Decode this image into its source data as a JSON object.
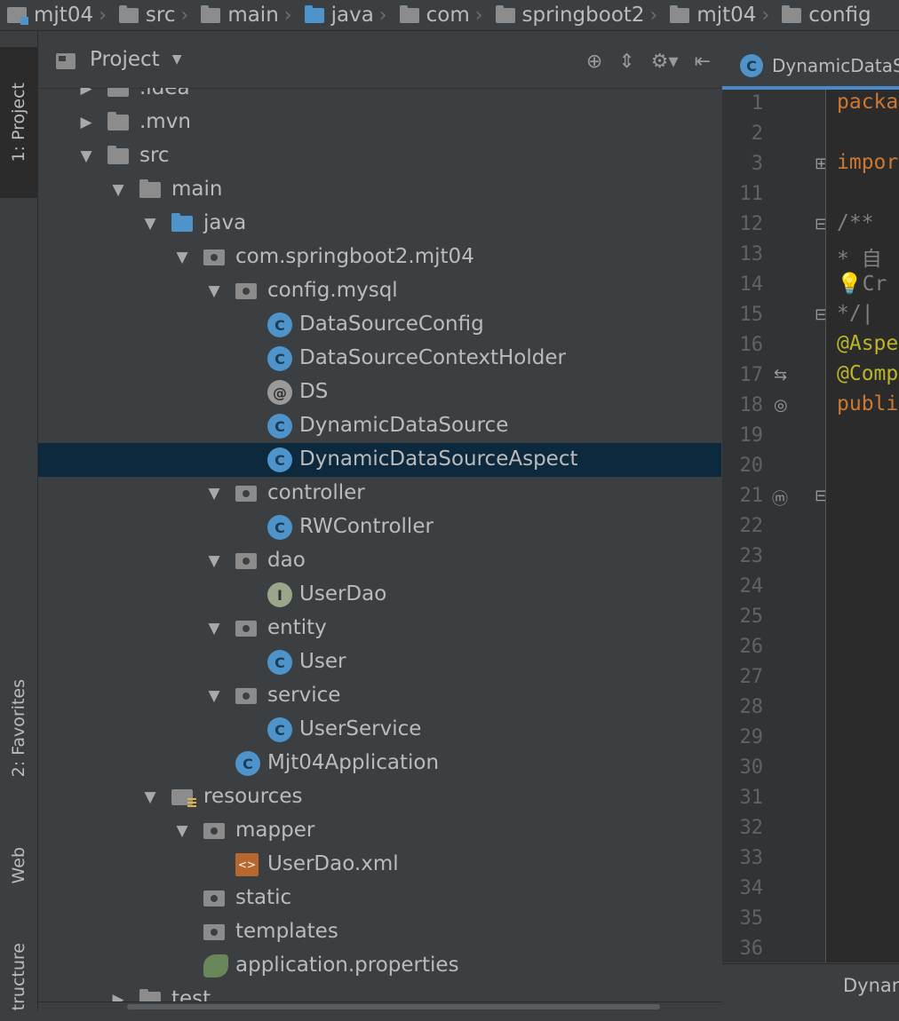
{
  "breadcrumbs": [
    "mjt04",
    "src",
    "main",
    "java",
    "com",
    "springboot2",
    "mjt04",
    "config"
  ],
  "tool_strip": {
    "project": "1: Project",
    "favorites": "2: Favorites",
    "web": "Web",
    "structure": "tructure"
  },
  "panel": {
    "title": "Project"
  },
  "tree": [
    {
      "label": ".idea",
      "arrow": "▶",
      "icon": "folder",
      "depth": 0
    },
    {
      "label": ".mvn",
      "arrow": "▶",
      "icon": "folder",
      "depth": 0
    },
    {
      "label": "src",
      "arrow": "▼",
      "icon": "folder",
      "depth": 0
    },
    {
      "label": "main",
      "arrow": "▼",
      "icon": "folder",
      "depth": 1
    },
    {
      "label": "java",
      "arrow": "▼",
      "icon": "folder-blue",
      "depth": 2
    },
    {
      "label": "com.springboot2.mjt04",
      "arrow": "▼",
      "icon": "package",
      "depth": 3
    },
    {
      "label": "config.mysql",
      "arrow": "▼",
      "icon": "package",
      "depth": 4
    },
    {
      "label": "DataSourceConfig",
      "arrow": "",
      "icon": "class",
      "depth": 5
    },
    {
      "label": "DataSourceContextHolder",
      "arrow": "",
      "icon": "class",
      "depth": 5
    },
    {
      "label": "DS",
      "arrow": "",
      "icon": "annotation",
      "depth": 5
    },
    {
      "label": "DynamicDataSource",
      "arrow": "",
      "icon": "class",
      "depth": 5
    },
    {
      "label": "DynamicDataSourceAspect",
      "arrow": "",
      "icon": "class",
      "depth": 5,
      "selected": true
    },
    {
      "label": "controller",
      "arrow": "▼",
      "icon": "package",
      "depth": 4
    },
    {
      "label": "RWController",
      "arrow": "",
      "icon": "class",
      "depth": 5
    },
    {
      "label": "dao",
      "arrow": "▼",
      "icon": "package",
      "depth": 4
    },
    {
      "label": "UserDao",
      "arrow": "",
      "icon": "interface",
      "depth": 5
    },
    {
      "label": "entity",
      "arrow": "▼",
      "icon": "package",
      "depth": 4
    },
    {
      "label": "User",
      "arrow": "",
      "icon": "class",
      "depth": 5
    },
    {
      "label": "service",
      "arrow": "▼",
      "icon": "package",
      "depth": 4
    },
    {
      "label": "UserService",
      "arrow": "",
      "icon": "class",
      "depth": 5
    },
    {
      "label": "Mjt04Application",
      "arrow": "",
      "icon": "app-class",
      "depth": 4
    },
    {
      "label": "resources",
      "arrow": "▼",
      "icon": "resources",
      "depth": 2
    },
    {
      "label": "mapper",
      "arrow": "▼",
      "icon": "package",
      "depth": 3
    },
    {
      "label": "UserDao.xml",
      "arrow": "",
      "icon": "xml",
      "depth": 4
    },
    {
      "label": "static",
      "arrow": "",
      "icon": "package",
      "depth": 3
    },
    {
      "label": "templates",
      "arrow": "",
      "icon": "package",
      "depth": 3
    },
    {
      "label": "application.properties",
      "arrow": "",
      "icon": "properties",
      "depth": 3
    },
    {
      "label": "test",
      "arrow": "▶",
      "icon": "folder",
      "depth": 1
    }
  ],
  "editor": {
    "tab_label": "DynamicDataS",
    "line_numbers": [
      "1",
      "2",
      "3",
      "11",
      "12",
      "13",
      "14",
      "15",
      "16",
      "17",
      "18",
      "19",
      "20",
      "21",
      "22",
      "23",
      "24",
      "25",
      "26",
      "27",
      "28",
      "29",
      "30",
      "31",
      "32",
      "33",
      "34",
      "35",
      "36"
    ],
    "code_lines": [
      {
        "text": "packa",
        "cls": "kw"
      },
      {
        "text": "",
        "cls": ""
      },
      {
        "text": "impor",
        "cls": "kw"
      },
      {
        "text": "",
        "cls": ""
      },
      {
        "text": "/**",
        "cls": "cm"
      },
      {
        "text": " * 自",
        "cls": "cm"
      },
      {
        "text": "💡Cr",
        "cls": "cm"
      },
      {
        "text": " */|",
        "cls": "cm"
      },
      {
        "text": "@Aspe",
        "cls": "an"
      },
      {
        "text": "@Comp",
        "cls": "an"
      },
      {
        "text": "publi",
        "cls": "kw"
      }
    ],
    "bottom_label": "Dynar"
  }
}
